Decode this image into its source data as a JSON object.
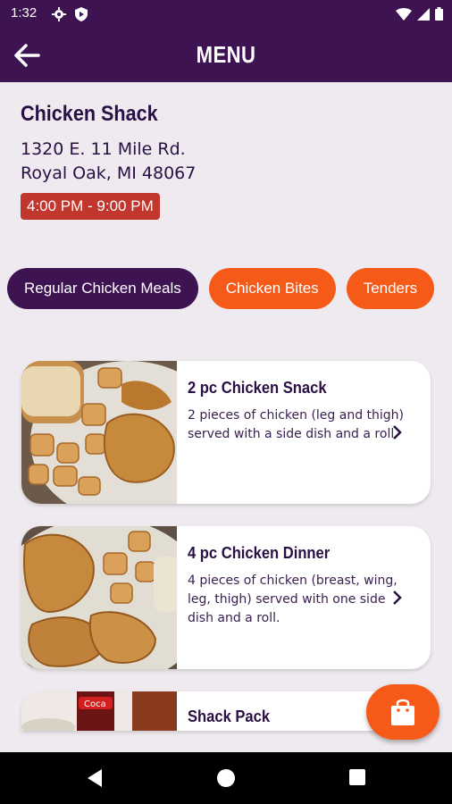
{
  "status_bar": {
    "time": "1:32"
  },
  "app_bar": {
    "title": "MENU"
  },
  "restaurant": {
    "name": "Chicken Shack",
    "address_line1": "1320 E. 11 Mile Rd.",
    "address_line2": "Royal Oak, MI 48067",
    "hours": "4:00 PM - 9:00 PM"
  },
  "categories": [
    "Regular Chicken Meals",
    "Chicken Bites",
    "Tenders"
  ],
  "menu_items": [
    {
      "title": "2 pc Chicken Snack",
      "description": "2 pieces of chicken (leg and thigh) served with a side dish and a roll."
    },
    {
      "title": "4 pc Chicken Dinner",
      "description": "4 pieces of chicken (breast, wing, leg, thigh) served with one side dish and a roll."
    },
    {
      "title": "Shack Pack",
      "description": ""
    }
  ],
  "colors": {
    "brand_purple": "#3d1352",
    "accent_orange": "#f55a18",
    "hours_red": "#c1372d"
  },
  "icons": [
    "settings-icon",
    "shield-icon",
    "wifi-icon",
    "signal-icon",
    "battery-icon",
    "back-arrow-icon",
    "chevron-right-icon",
    "shopping-bag-icon",
    "nav-back-icon",
    "nav-home-icon",
    "nav-recents-icon"
  ]
}
